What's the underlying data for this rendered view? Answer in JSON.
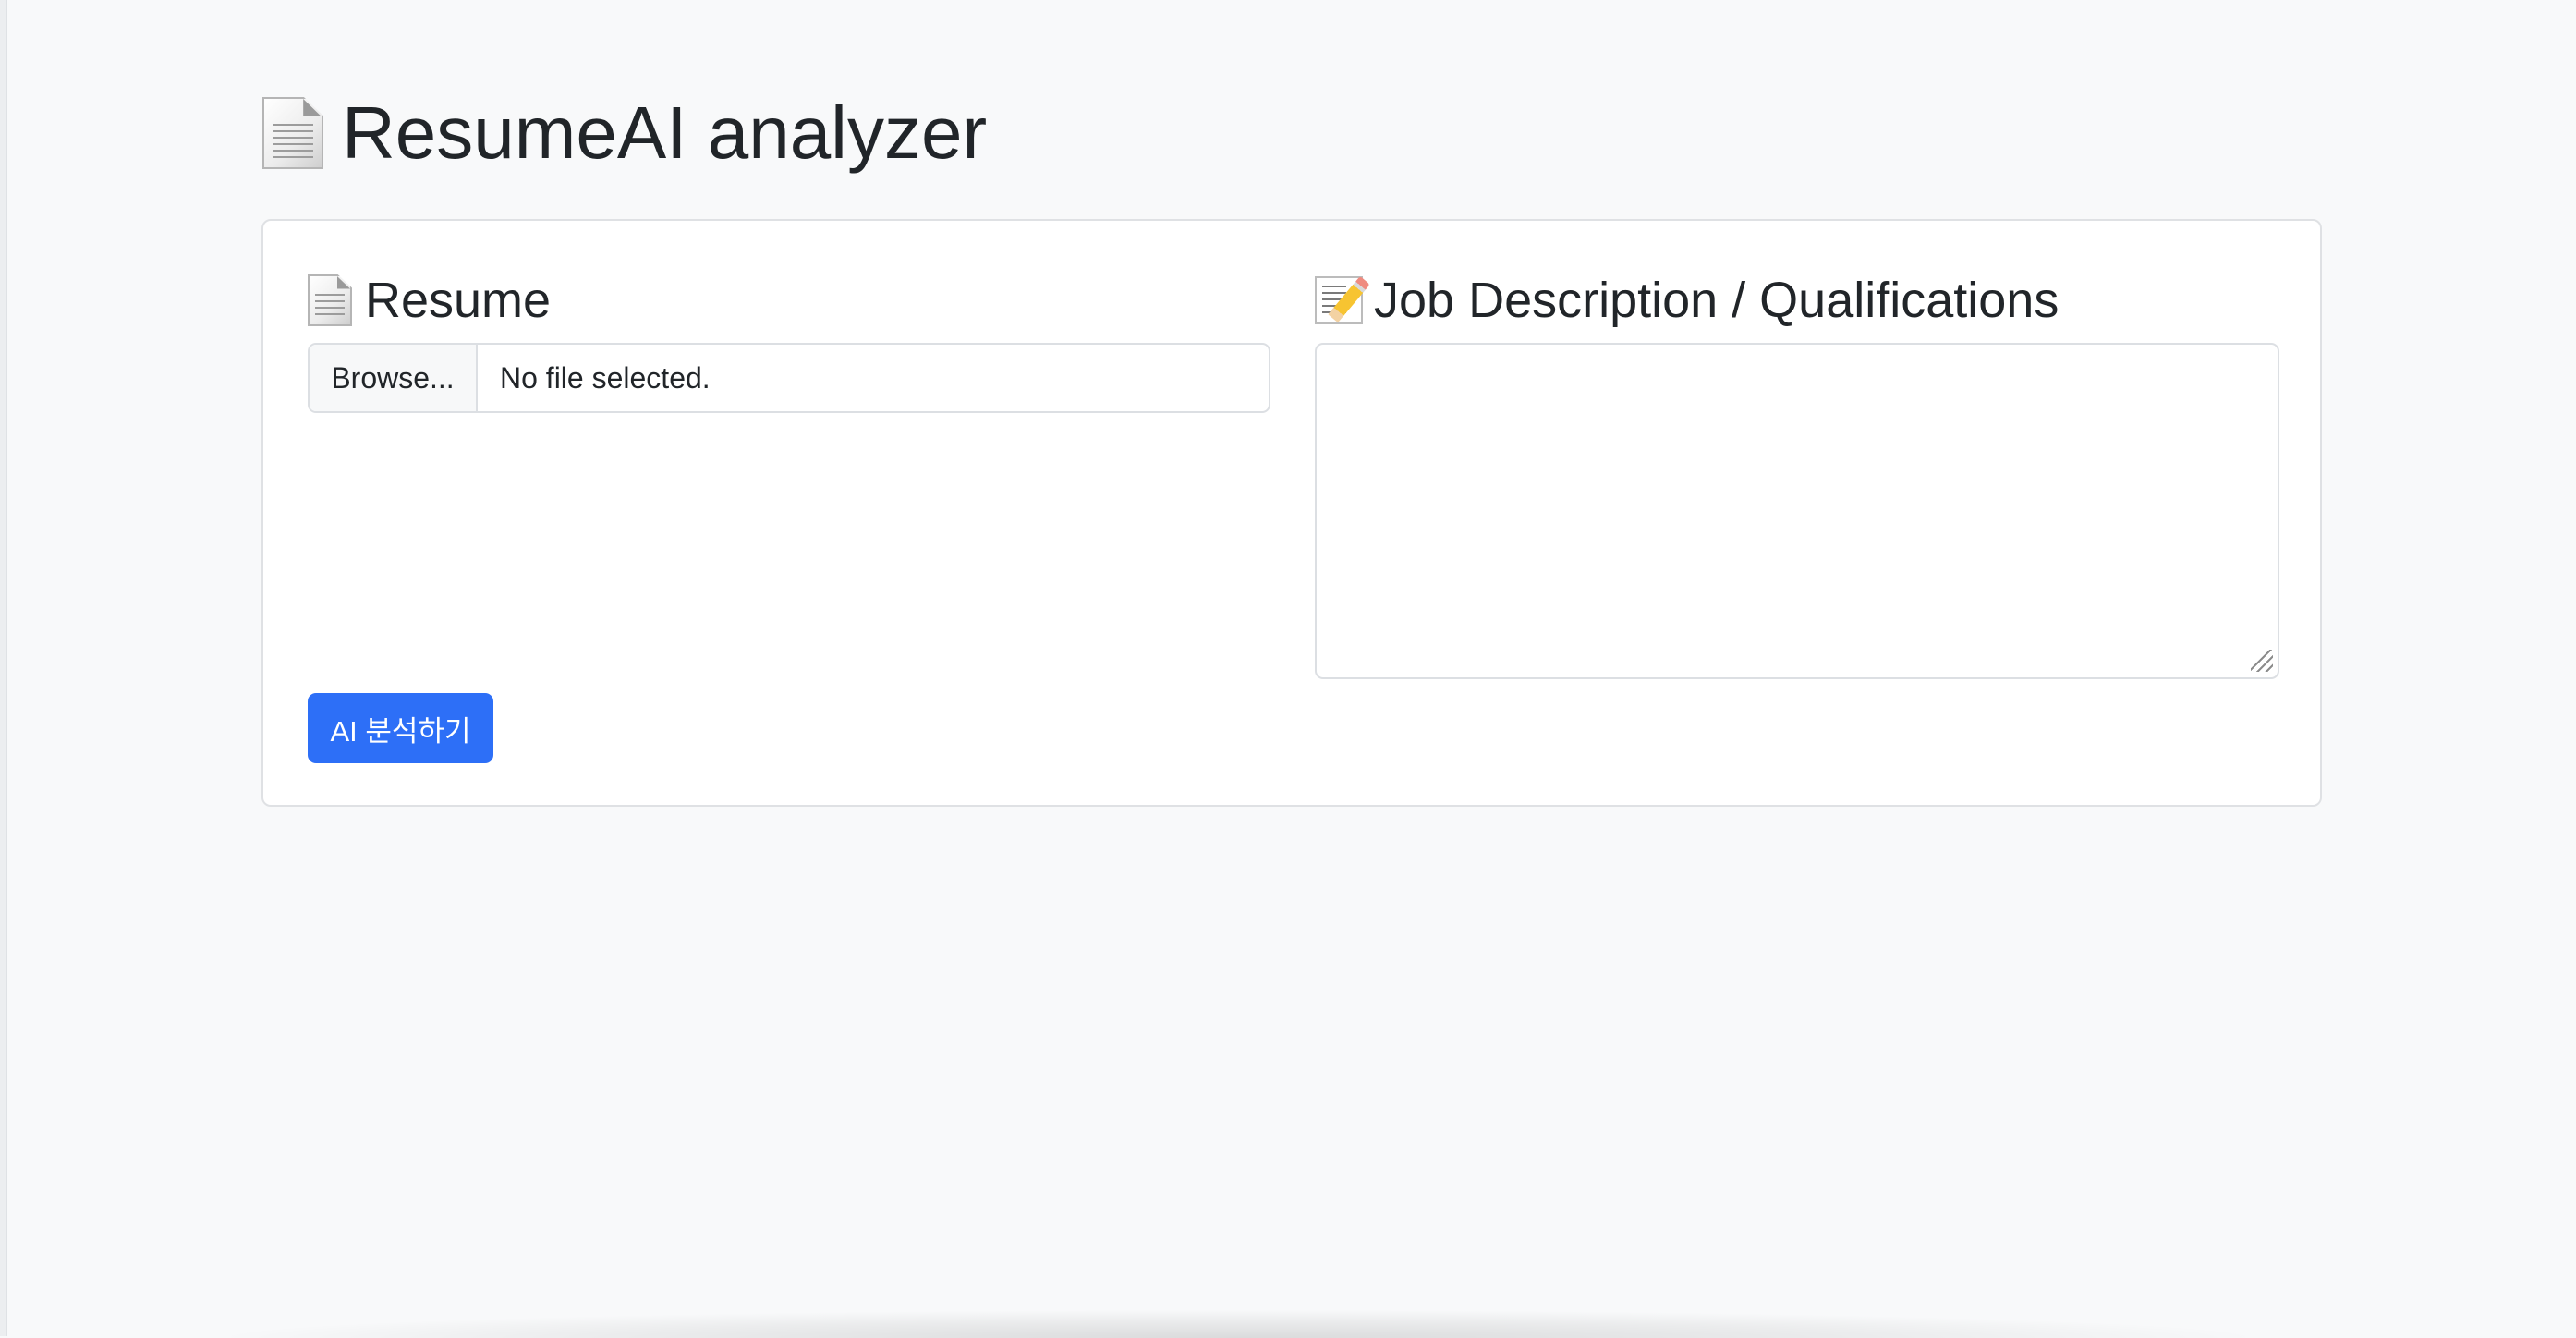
{
  "page": {
    "title": "ResumeAI analyzer",
    "title_icon": "page-document-icon"
  },
  "resume_section": {
    "heading": "Resume",
    "heading_icon": "page-document-icon",
    "browse_label": "Browse...",
    "file_status": "No file selected."
  },
  "job_section": {
    "heading": "Job Description / Qualifications",
    "heading_icon": "memo-pencil-icon",
    "textarea_value": ""
  },
  "actions": {
    "analyze_label": "AI 분석하기"
  },
  "colors": {
    "background": "#f8f9fa",
    "card": "#ffffff",
    "primary": "#2d6ff7",
    "text": "#212529",
    "border": "#dcdfe3"
  }
}
